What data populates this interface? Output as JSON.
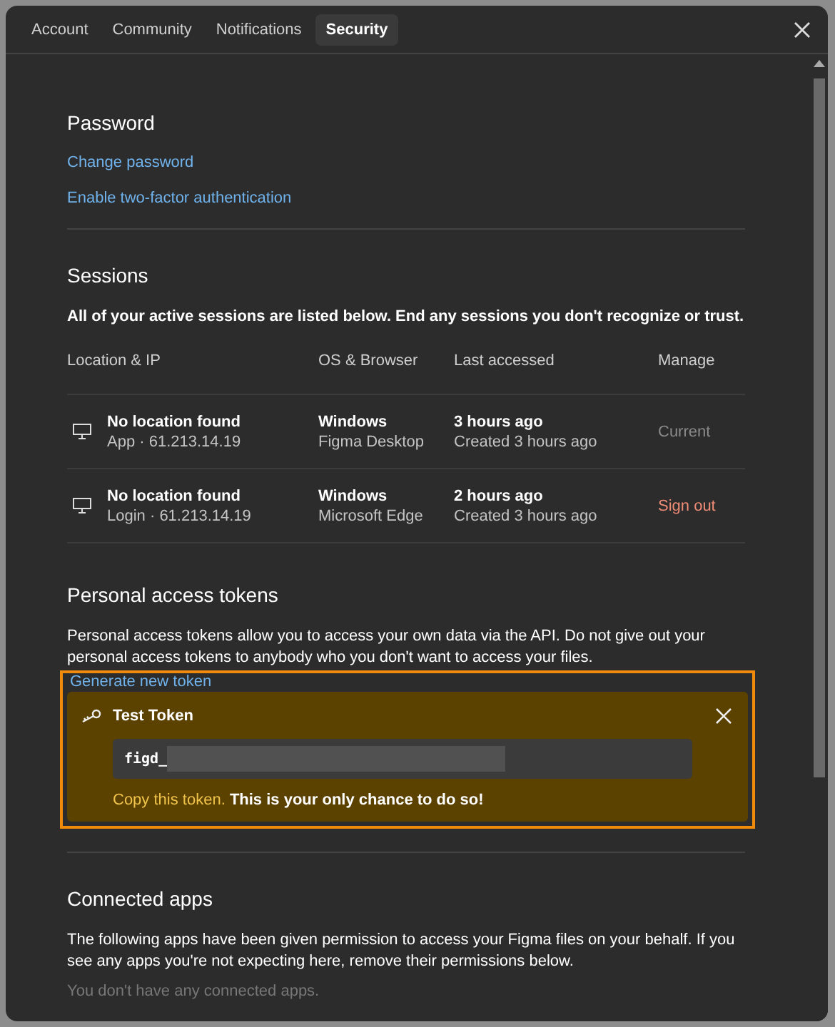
{
  "tabs": [
    {
      "label": "Account",
      "selected": false
    },
    {
      "label": "Community",
      "selected": false
    },
    {
      "label": "Notifications",
      "selected": false
    },
    {
      "label": "Security",
      "selected": true
    }
  ],
  "password": {
    "title": "Password",
    "links": [
      "Change password",
      "Enable two-factor authentication"
    ]
  },
  "sessions": {
    "title": "Sessions",
    "description": "All of your active sessions are listed below. End any sessions you don't recognize or trust.",
    "columns": [
      "Location & IP",
      "OS & Browser",
      "Last accessed",
      "Manage"
    ],
    "rows": [
      {
        "location": "No location found",
        "source": "App · 61.213.14.19",
        "os": "Windows",
        "browser": "Figma Desktop",
        "last": "3 hours ago",
        "created": "Created 3 hours ago",
        "manage": {
          "kind": "current",
          "label": "Current"
        }
      },
      {
        "location": "No location found",
        "source": "Login · 61.213.14.19",
        "os": "Windows",
        "browser": "Microsoft Edge",
        "last": "2 hours ago",
        "created": "Created 3 hours ago",
        "manage": {
          "kind": "action",
          "label": "Sign out"
        }
      }
    ]
  },
  "tokens": {
    "title": "Personal access tokens",
    "description": "Personal access tokens allow you to access your own data via the API. Do not give out your personal access tokens to anybody who you don't want to access your files.",
    "generate": "Generate new token",
    "new_token": {
      "name": "Test Token",
      "value": "figd_",
      "warning_highlight": "Copy this token.",
      "warning": "This is your only chance to do so!"
    }
  },
  "connected_apps": {
    "title": "Connected apps",
    "description": "The following apps have been given permission to access your Figma files on your behalf. If you see any apps you're not expecting here, remove their permissions below.",
    "empty": "You don't have any connected apps."
  }
}
